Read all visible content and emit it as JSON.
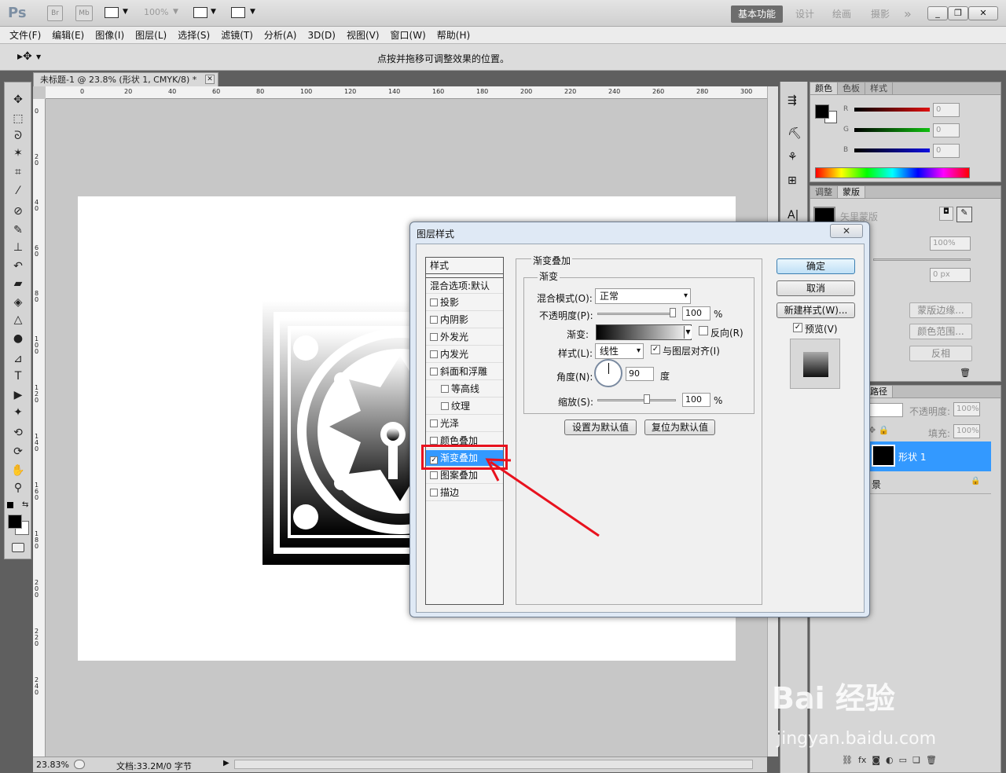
{
  "app": {
    "logo": "Ps",
    "bridge_label": "Br",
    "minibridge_label": "Mb",
    "zoom_value": "100%",
    "workspaces": [
      "基本功能",
      "设计",
      "绘画",
      "摄影"
    ],
    "more_workspaces": "»"
  },
  "menu": [
    "文件(F)",
    "编辑(E)",
    "图像(I)",
    "图层(L)",
    "选择(S)",
    "滤镜(T)",
    "分析(A)",
    "3D(D)",
    "视图(V)",
    "窗口(W)",
    "帮助(H)"
  ],
  "options_hint": "点按并拖移可调整效果的位置。",
  "document": {
    "tab_title": "未标题-1 @ 23.8% (形状 1, CMYK/8) *",
    "ruler_h": [
      "0",
      "20",
      "40",
      "60",
      "80",
      "100",
      "120",
      "140",
      "160",
      "180",
      "200",
      "220",
      "240",
      "260",
      "280",
      "300"
    ],
    "ruler_v": [
      "0",
      "2 0",
      "4 0",
      "6 0",
      "8 0",
      "1 0 0",
      "1 2 0",
      "1 4 0",
      "1 6 0",
      "1 8 0",
      "2 0 0",
      "2 2 0",
      "2 4 0"
    ],
    "zoom_status": "23.83%",
    "doc_status": "文档:33.2M/0 字节"
  },
  "color_panel": {
    "tabs": [
      "颜色",
      "色板",
      "样式"
    ],
    "channels": [
      {
        "label": "R",
        "value": "0",
        "color": "#e01010"
      },
      {
        "label": "G",
        "value": "0",
        "color": "#10c010"
      },
      {
        "label": "B",
        "value": "0",
        "color": "#1010e0"
      }
    ]
  },
  "adjust_panel": {
    "tabs": [
      "调整",
      "蒙版"
    ],
    "mask_label": "矢里蒙版",
    "density_value": "100%",
    "feather_value": "0 px",
    "buttons": [
      "蒙版边缘...",
      "颜色范围...",
      "反相"
    ]
  },
  "layers_panel": {
    "tab_label": "路径",
    "opacity_label": "不透明度:",
    "opacity_value": "100%",
    "fill_label": "填充:",
    "fill_value": "100%",
    "layers": [
      {
        "name": "形状 1",
        "selected": true
      },
      {
        "name": "景",
        "selected": false
      }
    ]
  },
  "dialog": {
    "title": "图层样式",
    "close": "✕",
    "styles_header": "样式",
    "blend_default": "混合选项:默认",
    "style_items": [
      {
        "label": "投影",
        "checked": false,
        "sub": false
      },
      {
        "label": "内阴影",
        "checked": false,
        "sub": false
      },
      {
        "label": "外发光",
        "checked": false,
        "sub": false
      },
      {
        "label": "内发光",
        "checked": false,
        "sub": false
      },
      {
        "label": "斜面和浮雕",
        "checked": false,
        "sub": false
      },
      {
        "label": "等高线",
        "checked": false,
        "sub": true
      },
      {
        "label": "纹理",
        "checked": false,
        "sub": true
      },
      {
        "label": "光泽",
        "checked": false,
        "sub": false
      },
      {
        "label": "颜色叠加",
        "checked": false,
        "sub": false
      },
      {
        "label": "渐变叠加",
        "checked": true,
        "sub": false,
        "selected": true
      },
      {
        "label": "图案叠加",
        "checked": false,
        "sub": false
      },
      {
        "label": "描边",
        "checked": false,
        "sub": false
      }
    ],
    "section_title": "渐变叠加",
    "subsection_title": "渐变",
    "blend_mode_label": "混合模式(O):",
    "blend_mode_value": "正常",
    "opacity_label": "不透明度(P):",
    "opacity_value": "100",
    "percent": "%",
    "gradient_label": "渐变:",
    "reverse_label": "反向(R)",
    "style_label": "样式(L):",
    "style_value": "线性",
    "align_label": "与图层对齐(I)",
    "angle_label": "角度(N):",
    "angle_value": "90",
    "degree_unit": "度",
    "scale_label": "缩放(S):",
    "scale_value": "100",
    "set_default": "设置为默认值",
    "reset_default": "复位为默认值",
    "ok": "确定",
    "cancel": "取消",
    "new_style": "新建样式(W)...",
    "preview_label": "预览(V)"
  },
  "watermark": {
    "brand": "Bai 经验",
    "url": "jingyan.baidu.com"
  }
}
